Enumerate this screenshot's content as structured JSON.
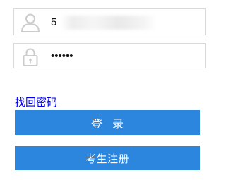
{
  "login_form": {
    "username": {
      "value": "5                    X",
      "icon": "user-icon"
    },
    "password": {
      "value": "••••••",
      "icon": "lock-icon"
    },
    "forgot_password_label": "找回密码",
    "login_button_label": "登录",
    "register_button_label": "考生注册"
  },
  "colors": {
    "button_bg": "#2d86de",
    "link": "#0000ee",
    "border": "#d9d9d9",
    "icon": "#cccccc"
  }
}
